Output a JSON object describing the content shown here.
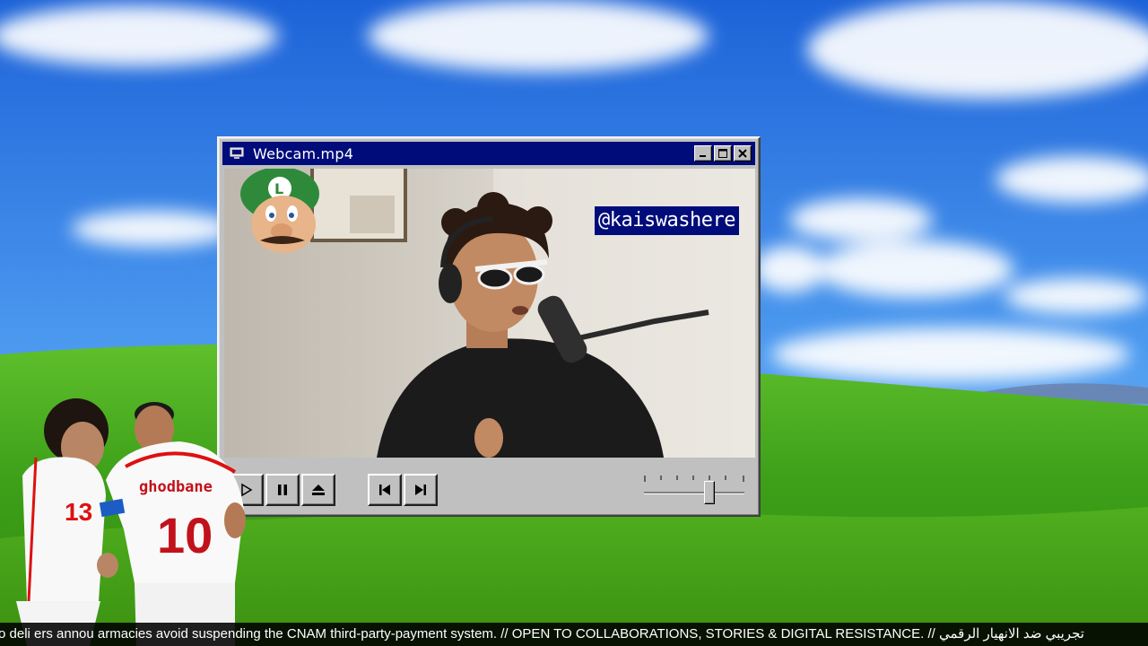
{
  "window": {
    "title": "Webcam.mp4",
    "buttons": {
      "minimize": "minimize",
      "maximize": "maximize",
      "close": "close"
    }
  },
  "overlay": {
    "handle": "@kaiswashere"
  },
  "players": {
    "left_number": "13",
    "right_name": "ghodbane",
    "right_number": "10"
  },
  "player_controls": {
    "buttons": [
      "play-icon",
      "pause-icon",
      "eject-icon",
      "skip-back-icon",
      "skip-forward-icon"
    ],
    "volume_level": 0.65
  },
  "ticker": {
    "text": "o deli        ers annou          armacies avoid suspending the CNAM third-party-payment system. // OPEN TO COLLABORATIONS, STORIES & DIGITAL RESISTANCE. // تجريبي ضد الانهيار الرقمي"
  },
  "colors": {
    "titlebar": "#000c7a",
    "window": "#c0c0c0",
    "ticker_bg": "#000000"
  }
}
